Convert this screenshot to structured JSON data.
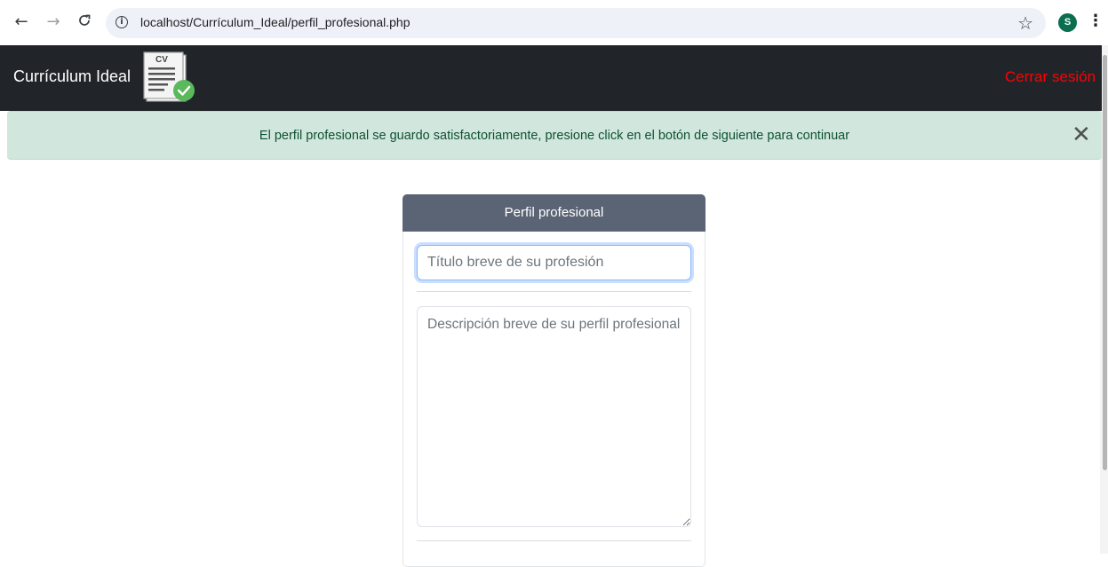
{
  "browser": {
    "url": "localhost/Currículum_Ideal/perfil_profesional.php",
    "back_glyph": "←",
    "forward_glyph": "→",
    "reload_glyph": "C",
    "info_glyph": "i",
    "star_glyph": "☆",
    "avatar_letter": "S",
    "menu_glyph": "⋮"
  },
  "navbar": {
    "brand": "Currículum Ideal",
    "logo_text": "CV",
    "logout_label": "Cerrar sesión",
    "background": "#212529",
    "logout_color": "#ff0000"
  },
  "alert": {
    "message": "El perfil profesional se guardo satisfactoriamente, presione click en el botón de siguiente para continuar",
    "close_glyph": "✕",
    "background": "#d1e7dd"
  },
  "form": {
    "header": "Perfil profesional",
    "title_placeholder": "Título breve de su profesión",
    "description_placeholder": "Descripción breve de su perfil profesional",
    "header_background": "#5b6475"
  }
}
